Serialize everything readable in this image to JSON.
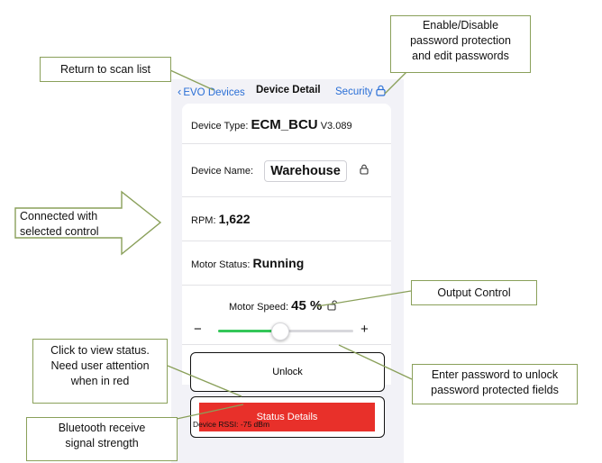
{
  "nav": {
    "back_label": "EVO Devices",
    "title": "Device Detail",
    "security_label": "Security"
  },
  "rows": {
    "device_type_label": "Device Type:",
    "device_type_value": "ECM_BCU",
    "version": "V3.089",
    "device_name_label": "Device Name:",
    "device_name_value": "Warehouse",
    "rpm_label": "RPM:",
    "rpm_value": "1,622",
    "motor_status_label": "Motor Status:",
    "motor_status_value": "Running",
    "motor_speed_label": "Motor Speed:",
    "motor_speed_value": "45 %",
    "motor_speed_fraction": 0.45,
    "minus": "−",
    "plus": "+"
  },
  "buttons": {
    "unlock": "Unlock",
    "status": "Status Details"
  },
  "rssi": "Device RSSI: -75 dBm",
  "callouts": {
    "return": "Return to scan list",
    "security_line1": "Enable/Disable",
    "security_line2": "password protection",
    "security_line3": "and edit passwords",
    "connected_line1": "Connected with",
    "connected_line2": "selected control",
    "output": "Output Control",
    "status_line1": "Click to view status.",
    "status_line2": "Need user attention",
    "status_line3": "when in red",
    "unlock_line1": "Enter password to unlock",
    "unlock_line2": "password protected fields",
    "rssi_line1": "Bluetooth receive",
    "rssi_line2": "signal strength"
  },
  "colors": {
    "accent": "#2a6fd6",
    "slider": "#34c759",
    "status_red": "#e8302a",
    "callout_border": "#8aa05a"
  }
}
